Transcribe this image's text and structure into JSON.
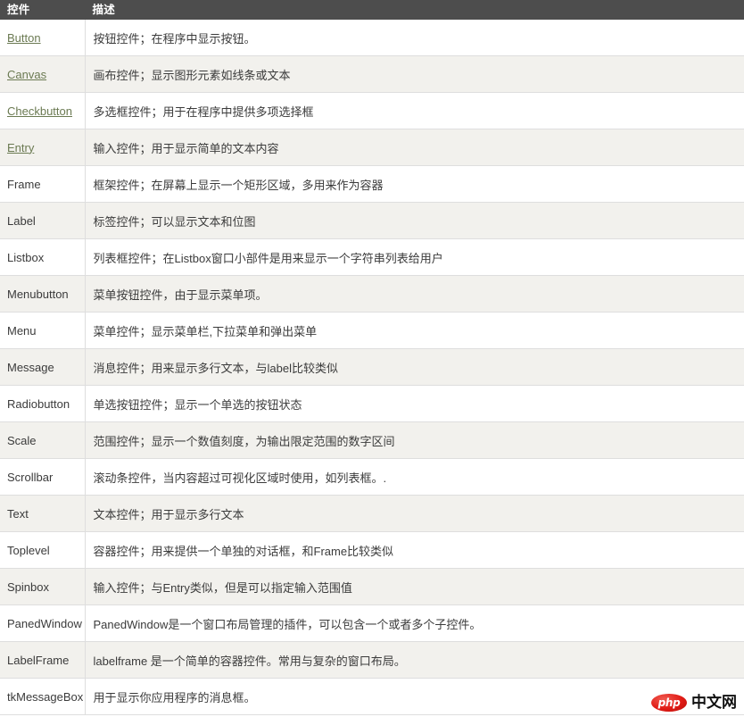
{
  "table": {
    "columns": [
      {
        "key": "widget",
        "label": "控件"
      },
      {
        "key": "description",
        "label": "描述"
      }
    ],
    "rows": [
      {
        "widget": "Button",
        "link": true,
        "description": "按钮控件；在程序中显示按钮。"
      },
      {
        "widget": "Canvas",
        "link": true,
        "description": "画布控件；显示图形元素如线条或文本"
      },
      {
        "widget": "Checkbutton",
        "link": true,
        "description": "多选框控件；用于在程序中提供多项选择框"
      },
      {
        "widget": "Entry",
        "link": true,
        "description": "输入控件；用于显示简单的文本内容"
      },
      {
        "widget": "Frame",
        "link": false,
        "description": "框架控件；在屏幕上显示一个矩形区域，多用来作为容器"
      },
      {
        "widget": "Label",
        "link": false,
        "description": "标签控件；可以显示文本和位图"
      },
      {
        "widget": "Listbox",
        "link": false,
        "description": "列表框控件；在Listbox窗口小部件是用来显示一个字符串列表给用户"
      },
      {
        "widget": "Menubutton",
        "link": false,
        "description": "菜单按钮控件，由于显示菜单项。"
      },
      {
        "widget": "Menu",
        "link": false,
        "description": "菜单控件；显示菜单栏,下拉菜单和弹出菜单"
      },
      {
        "widget": "Message",
        "link": false,
        "description": "消息控件；用来显示多行文本，与label比较类似"
      },
      {
        "widget": "Radiobutton",
        "link": false,
        "description": "单选按钮控件；显示一个单选的按钮状态"
      },
      {
        "widget": "Scale",
        "link": false,
        "description": "范围控件；显示一个数值刻度，为输出限定范围的数字区间"
      },
      {
        "widget": "Scrollbar",
        "link": false,
        "description": "滚动条控件，当内容超过可视化区域时使用，如列表框。."
      },
      {
        "widget": "Text",
        "link": false,
        "description": "文本控件；用于显示多行文本"
      },
      {
        "widget": "Toplevel",
        "link": false,
        "description": "容器控件；用来提供一个单独的对话框，和Frame比较类似"
      },
      {
        "widget": "Spinbox",
        "link": false,
        "description": "输入控件；与Entry类似，但是可以指定输入范围值"
      },
      {
        "widget": "PanedWindow",
        "link": false,
        "description": "PanedWindow是一个窗口布局管理的插件，可以包含一个或者多个子控件。"
      },
      {
        "widget": "LabelFrame",
        "link": false,
        "description": "labelframe 是一个简单的容器控件。常用与复杂的窗口布局。"
      },
      {
        "widget": "tkMessageBox",
        "link": false,
        "description": "用于显示你应用程序的消息框。"
      }
    ]
  },
  "watermark": {
    "badge": "php",
    "text": "中文网"
  },
  "theme": {
    "header_bg": "#4d4d4d",
    "header_fg": "#ffffff",
    "row_bg": "#ffffff",
    "row_alt_bg": "#f2f1ed",
    "border": "#dedede",
    "link": "#6b7a52",
    "text": "#3b3b3b",
    "badge_red": "#e11b15"
  }
}
